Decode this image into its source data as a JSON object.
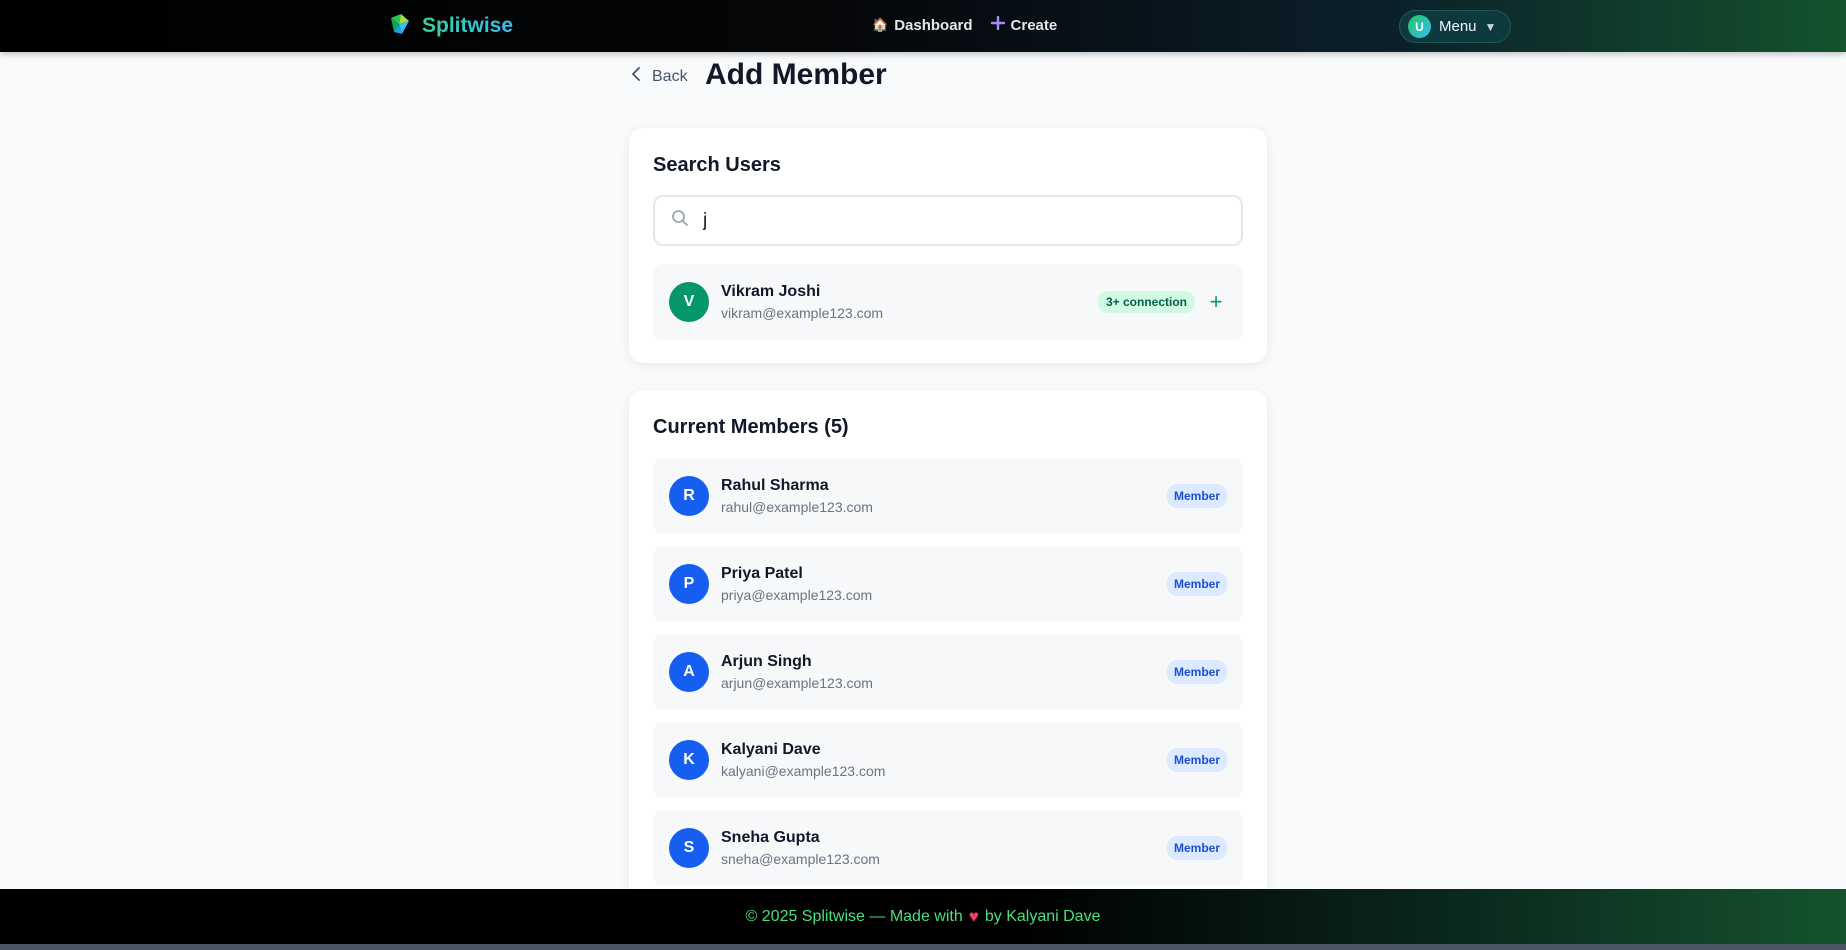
{
  "nav": {
    "brand": "Splitwise",
    "links": [
      {
        "icon": "🏠",
        "label": "Dashboard"
      },
      {
        "icon": "+",
        "label": "Create"
      }
    ],
    "menu": {
      "avatar_initial": "U",
      "label": "Menu"
    }
  },
  "header": {
    "back_label": "Back",
    "title": "Add Member"
  },
  "search": {
    "title": "Search Users",
    "query": "j",
    "result": {
      "initial": "V",
      "name": "Vikram Joshi",
      "email": "vikram@example123.com",
      "badge": "3+ connection",
      "add_label": "+"
    }
  },
  "members": {
    "title": "Current Members (5)",
    "badge_label": "Member",
    "items": [
      {
        "initial": "R",
        "name": "Rahul Sharma",
        "email": "rahul@example123.com"
      },
      {
        "initial": "P",
        "name": "Priya Patel",
        "email": "priya@example123.com"
      },
      {
        "initial": "A",
        "name": "Arjun Singh",
        "email": "arjun@example123.com"
      },
      {
        "initial": "K",
        "name": "Kalyani Dave",
        "email": "kalyani@example123.com"
      },
      {
        "initial": "S",
        "name": "Sneha Gupta",
        "email": "sneha@example123.com"
      }
    ]
  },
  "footer": {
    "prefix": "© 2025 Splitwise — Made with",
    "heart": "♥",
    "suffix": "by Kalyani Dave"
  },
  "colors": {
    "accent_green": "#059669",
    "member_blue": "#155eef",
    "footer_text": "#4ade80"
  }
}
